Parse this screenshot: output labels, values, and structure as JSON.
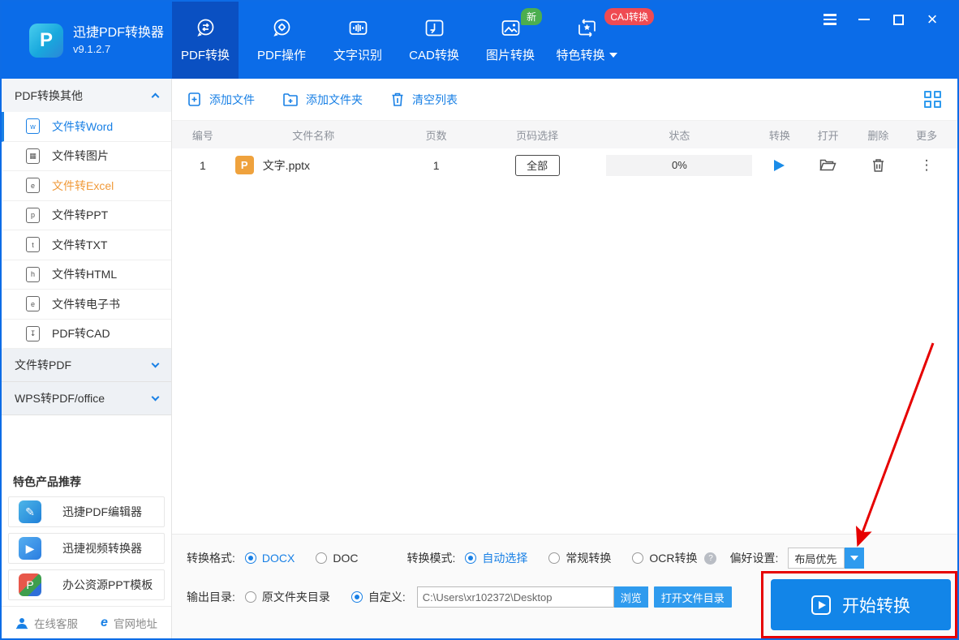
{
  "header": {
    "app_title": "迅捷PDF转换器",
    "version": "v9.1.2.7",
    "logo_letter": "P",
    "tabs": [
      {
        "label": "PDF转换",
        "active": true
      },
      {
        "label": "PDF操作",
        "active": false
      },
      {
        "label": "文字识别",
        "active": false
      },
      {
        "label": "CAD转换",
        "active": false
      },
      {
        "label": "图片转换",
        "active": false,
        "badge": "新"
      },
      {
        "label": "特色转换",
        "active": false,
        "badge": "CAJ转换"
      }
    ]
  },
  "sidebar": {
    "section_title": "PDF转换其他",
    "items": [
      {
        "label": "文件转Word",
        "glyph": "w"
      },
      {
        "label": "文件转图片",
        "glyph": "▦"
      },
      {
        "label": "文件转Excel",
        "glyph": "e"
      },
      {
        "label": "文件转PPT",
        "glyph": "p"
      },
      {
        "label": "文件转TXT",
        "glyph": "t"
      },
      {
        "label": "文件转HTML",
        "glyph": "h"
      },
      {
        "label": "文件转电子书",
        "glyph": "e"
      },
      {
        "label": "PDF转CAD",
        "glyph": "↧"
      }
    ],
    "collapsed_sections": [
      {
        "title": "文件转PDF"
      },
      {
        "title": "WPS转PDF/office"
      }
    ],
    "promo_title": "特色产品推荐",
    "promos": [
      {
        "label": "迅捷PDF编辑器",
        "glyph": "✎"
      },
      {
        "label": "迅捷视频转换器",
        "glyph": "▶"
      },
      {
        "label": "办公资源PPT模板",
        "glyph": "P"
      }
    ],
    "footer": [
      {
        "label": "在线客服"
      },
      {
        "label": "官网地址",
        "glyph": "e"
      }
    ]
  },
  "toolbar": {
    "add_file": "添加文件",
    "add_folder": "添加文件夹",
    "clear_list": "清空列表"
  },
  "table": {
    "headers": [
      "编号",
      "文件名称",
      "页数",
      "页码选择",
      "状态",
      "转换",
      "打开",
      "删除",
      "更多"
    ],
    "rows": [
      {
        "index": "1",
        "file_badge": "P",
        "file_name": "文字.pptx",
        "pages": "1",
        "page_select": "全部",
        "progress": "0%",
        "more_glyph": "⋮"
      }
    ]
  },
  "settings": {
    "format_label": "转换格式:",
    "format_options": [
      {
        "label": "DOCX",
        "selected": true
      },
      {
        "label": "DOC",
        "selected": false
      }
    ],
    "mode_label": "转换模式:",
    "mode_options": [
      {
        "label": "自动选择",
        "selected": true
      },
      {
        "label": "常规转换",
        "selected": false
      },
      {
        "label": "OCR转换",
        "selected": false
      }
    ],
    "help_glyph": "?",
    "pref_label": "偏好设置:",
    "pref_value": "布局优先",
    "output_label": "输出目录:",
    "output_options": [
      {
        "label": "原文件夹目录",
        "selected": false
      },
      {
        "label": "自定义:",
        "selected": true
      }
    ],
    "output_path": "C:\\Users\\xr102372\\Desktop",
    "browse_label": "浏览",
    "open_dir_label": "打开文件目录",
    "start_label": "开始转换"
  },
  "icons": {
    "close": "×"
  },
  "colors": {
    "header_blue": "#0b6ce8",
    "active_tab_blue": "#0a50c2",
    "accent_blue": "#1980e5",
    "light_button_blue": "#2f9bee",
    "excel_orange": "#f09a3a",
    "badge_green": "#4cae4f",
    "badge_red": "#ef4b52",
    "annotation_red": "#e60000"
  }
}
